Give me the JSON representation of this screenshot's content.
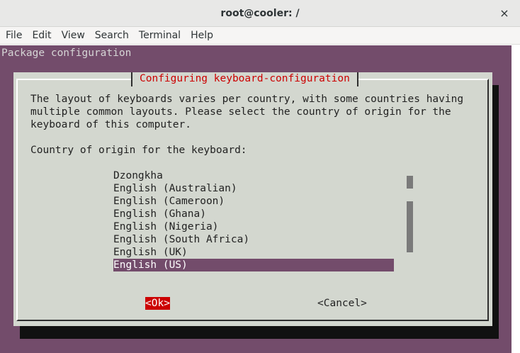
{
  "window": {
    "title": "root@cooler: /",
    "close_glyph": "×"
  },
  "menubar": {
    "items": [
      "File",
      "Edit",
      "View",
      "Search",
      "Terminal",
      "Help"
    ]
  },
  "terminal": {
    "header": "Package configuration",
    "background_color": "#734c6b"
  },
  "dialog": {
    "title": "Configuring keyboard-configuration",
    "description": "The layout of keyboards varies per country, with some countries having\nmultiple common layouts. Please select the country of origin for the\nkeyboard of this computer.",
    "prompt": "Country of origin for the keyboard:",
    "options": [
      "Dzongkha",
      "English (Australian)",
      "English (Cameroon)",
      "English (Ghana)",
      "English (Nigeria)",
      "English (South Africa)",
      "English (UK)",
      "English (US)"
    ],
    "selected_option": "English (US)",
    "ok_label": "<Ok>",
    "cancel_label": "<Cancel>",
    "title_color": "#cc0000",
    "ok_color": "#cc0000"
  }
}
